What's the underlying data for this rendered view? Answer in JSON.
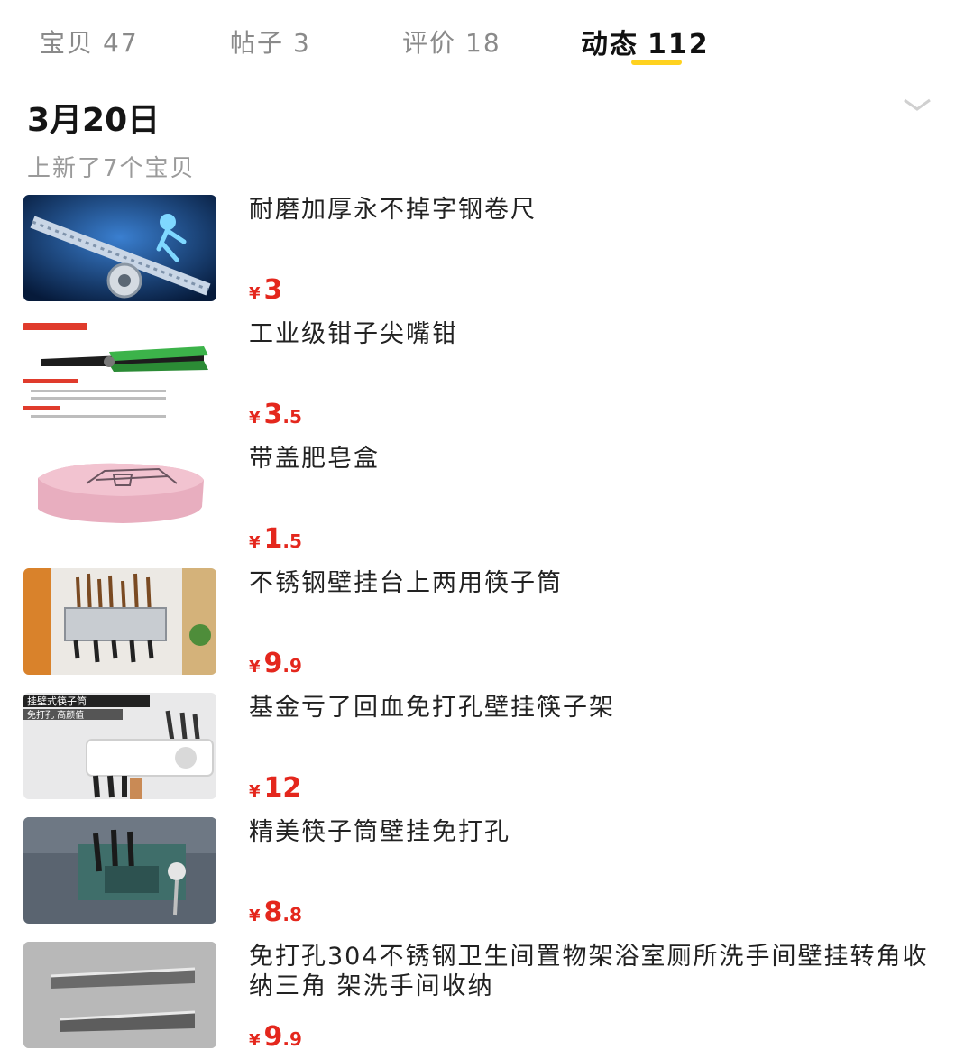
{
  "tabs": [
    {
      "label": "宝贝",
      "count": "47",
      "active": false
    },
    {
      "label": "帖子",
      "count": "3",
      "active": false
    },
    {
      "label": "评价",
      "count": "18",
      "active": false
    },
    {
      "label": "动态",
      "count": "112",
      "active": true
    }
  ],
  "feed": {
    "date": "3月20日",
    "summary": "上新了7个宝贝",
    "currency_symbol": "¥",
    "items": [
      {
        "title": "耐磨加厚永不掉字钢卷尺",
        "price_int": "3",
        "price_dec": "",
        "thumb_icon": "tape-measure-image"
      },
      {
        "title": "工业级钳子尖嘴钳",
        "price_int": "3",
        "price_dec": ".5",
        "thumb_icon": "pliers-image"
      },
      {
        "title": "带盖肥皂盒",
        "price_int": "1",
        "price_dec": ".5",
        "thumb_icon": "soap-box-image"
      },
      {
        "title": "不锈钢壁挂台上两用筷子筒",
        "price_int": "9",
        "price_dec": ".9",
        "thumb_icon": "chopstick-holder-image"
      },
      {
        "title": "基金亏了回血免打孔壁挂筷子架",
        "price_int": "12",
        "price_dec": "",
        "thumb_icon": "wall-chopstick-rack-image",
        "thumb_text": [
          "挂壁式筷子筒",
          "免打孔 高颜值"
        ]
      },
      {
        "title": "精美筷子筒壁挂免打孔",
        "price_int": "8",
        "price_dec": ".8",
        "thumb_icon": "green-chopstick-holder-image"
      },
      {
        "title": "免打孔304不锈钢卫生间置物架浴室厕所洗手间壁挂转角收纳三角 架洗手间收纳",
        "price_int": "9",
        "price_dec": ".9",
        "thumb_icon": "corner-shelf-image"
      }
    ]
  },
  "colors": {
    "accent_underline": "#ffd21f",
    "price": "#e4271d"
  }
}
